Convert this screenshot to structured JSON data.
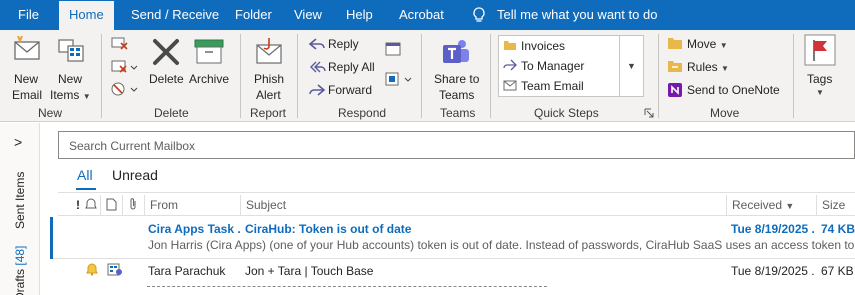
{
  "tabs": [
    "File",
    "Home",
    "Send / Receive",
    "Folder",
    "View",
    "Help",
    "Acrobat"
  ],
  "active_tab": "Home",
  "tell_me": "Tell me what you want to do",
  "ribbon": {
    "new_email": [
      "New",
      "Email"
    ],
    "new_items": [
      "New",
      "Items"
    ],
    "delete_label": "Delete",
    "archive_label": "Archive",
    "phish_alert": [
      "Phish",
      "Alert"
    ],
    "reply": "Reply",
    "reply_all": "Reply All",
    "forward": "Forward",
    "share_to_teams": [
      "Share to",
      "Teams"
    ],
    "quick_steps": [
      "Invoices",
      "To Manager",
      "Team Email"
    ],
    "move": "Move",
    "rules": "Rules",
    "send_to_onenote": "Send to OneNote",
    "tags": "Tags",
    "groups": [
      "New",
      "Delete",
      "Report",
      "Respond",
      "Teams",
      "Quick Steps",
      "Move"
    ]
  },
  "left_strip": {
    "collapse": ">",
    "sent_items": "Sent Items",
    "drafts": "Drafts",
    "drafts_count": "[48]"
  },
  "search": {
    "placeholder": "Search Current Mailbox"
  },
  "filters": {
    "all": "All",
    "unread": "Unread"
  },
  "columns": {
    "importance": "!",
    "from": "From",
    "subject": "Subject",
    "received": "Received",
    "size": "Size"
  },
  "messages": [
    {
      "from": "Cira Apps Task ...",
      "subject": "CiraHub: Token is out of date",
      "received": "Tue 8/19/2025 ...",
      "size": "74 KB",
      "preview": "Jon Harris (Cira Apps) (one of your Hub accounts) token is out of date.  Instead of passwords, CiraHub SaaS uses an access token to perform",
      "unread": true
    },
    {
      "from": "Tara Parachuk",
      "subject": "Jon + Tara | Touch Base",
      "received": "Tue 8/19/2025 ...",
      "size": "67 KB",
      "unread": false
    }
  ],
  "colors": {
    "brand": "#0f6cbd",
    "ribbon_bg": "#f3f2f1",
    "unread": "#0f6cbd",
    "onenote": "#7719aa",
    "teams": "#5b5fc7"
  }
}
